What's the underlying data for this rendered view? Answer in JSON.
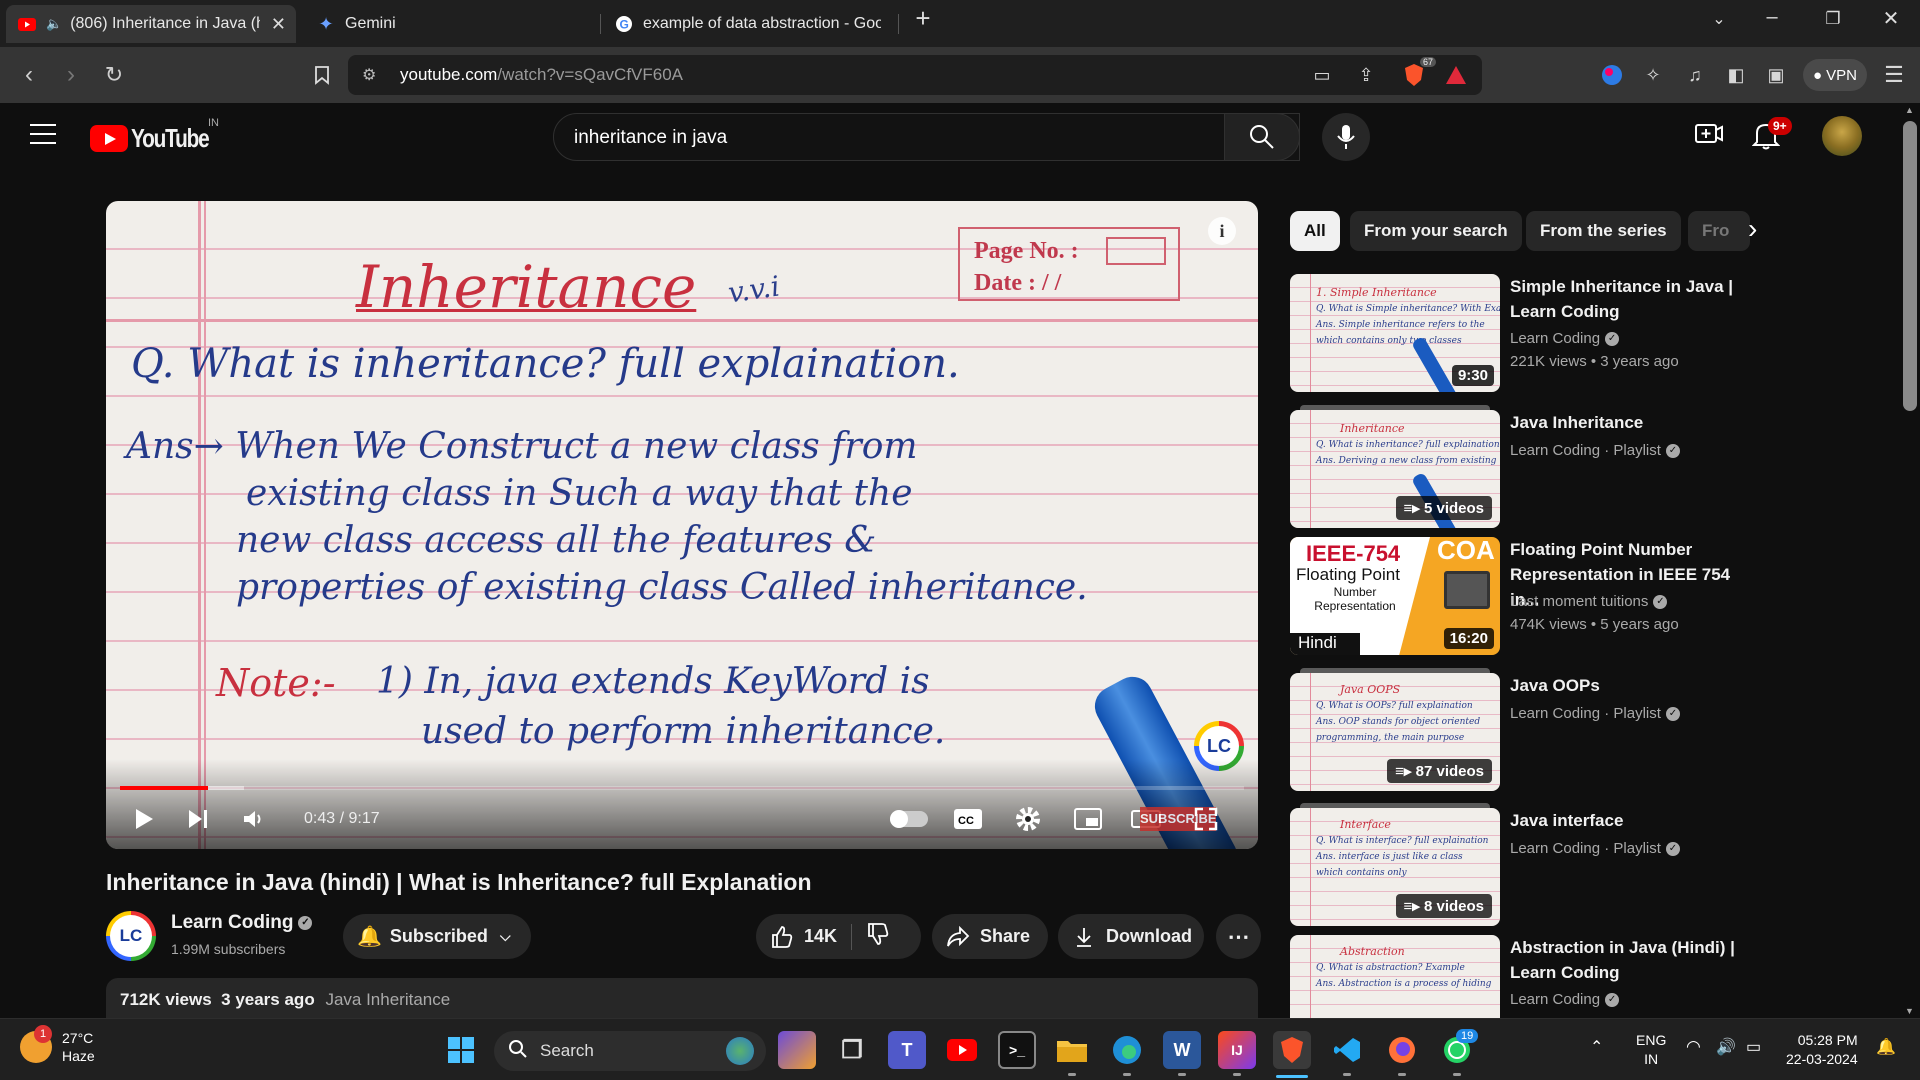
{
  "browser": {
    "tabs": [
      {
        "title": "(806) Inheritance in Java (hin",
        "active": true
      },
      {
        "title": "Gemini",
        "active": false
      },
      {
        "title": "example of data abstraction - Google",
        "active": false
      }
    ],
    "url_host": "youtube.com",
    "url_path": "/watch?v=sQavCfVF60A",
    "vpn_label": "VPN",
    "brave_count": "67"
  },
  "youtube": {
    "logo_text": "YouTube",
    "country": "IN",
    "search_query": "inheritance in java",
    "notification_count": "9+"
  },
  "video": {
    "board": {
      "page_no": "Page No. :",
      "date": "Date :   /   /",
      "title": "Inheritance",
      "vvi": "v.v.i",
      "question": "Q. What is inheritance? full explaination.",
      "ans1": "Ans→  When We Construct a new class from",
      "ans2": "existing class in Such a way that the",
      "ans3": "new class access all the features &",
      "ans4": "properties of existing class Called inheritance.",
      "note": "Note:-",
      "note1": "1) In, java extends KeyWord is",
      "note2": "used to perform inheritance."
    },
    "watermark": "LC",
    "progress": 0.078,
    "buffered": 0.11,
    "time": "0:43 / 9:17",
    "subscribe_overlay": "SUBSCRIBE",
    "title": "Inheritance in Java (hindi) | What is Inheritance? full Explanation",
    "channel": "Learn Coding",
    "channel_initials": "LC",
    "subscribers": "1.99M subscribers",
    "subscribed_label": "Subscribed",
    "likes": "14K",
    "share_label": "Share",
    "download_label": "Download",
    "views": "712K views",
    "age": "3 years ago",
    "playlist_tag": "Java Inheritance"
  },
  "chips": [
    "All",
    "From your search",
    "From the series",
    "Fro"
  ],
  "recommendations": [
    {
      "title": "Simple Inheritance in Java | Learn Coding",
      "channel": "Learn Coding",
      "meta": "221K views • 3 years ago",
      "badge": "9:30",
      "type": "video",
      "thumb_heading": "1. Simple Inheritance"
    },
    {
      "title": "Java Inheritance",
      "channel": "Learn Coding · Playlist",
      "meta": "",
      "badge": "5 videos",
      "type": "playlist",
      "thumb_heading": "Inheritance"
    },
    {
      "title": "Floating Point Number Representation in IEEE 754 in...",
      "channel": "Last moment tuitions",
      "meta": "474K views • 5 years ago",
      "badge": "16:20",
      "type": "ieee",
      "thumb_heading": "IEEE-754",
      "thumb_sub": "Floating Point",
      "thumb_sub2": "Number Representation",
      "thumb_tag": "COA",
      "thumb_lang": "Hindi"
    },
    {
      "title": "Java OOPs",
      "channel": "Learn Coding · Playlist",
      "meta": "",
      "badge": "87 videos",
      "type": "playlist",
      "thumb_heading": "Java OOPS"
    },
    {
      "title": "Java interface",
      "channel": "Learn Coding · Playlist",
      "meta": "",
      "badge": "8 videos",
      "type": "playlist",
      "thumb_heading": "Interface"
    },
    {
      "title": "Abstraction in Java (Hindi) | Learn Coding",
      "channel": "Learn Coding",
      "meta": "",
      "badge": "",
      "type": "video",
      "thumb_heading": "Abstraction"
    }
  ],
  "taskbar": {
    "temp": "27°C",
    "weather": "Haze",
    "weather_alert": "1",
    "search_label": "Search",
    "lang1": "ENG",
    "lang2": "IN",
    "time": "05:28 PM",
    "date": "22-03-2024",
    "whatsapp_count": "19"
  }
}
